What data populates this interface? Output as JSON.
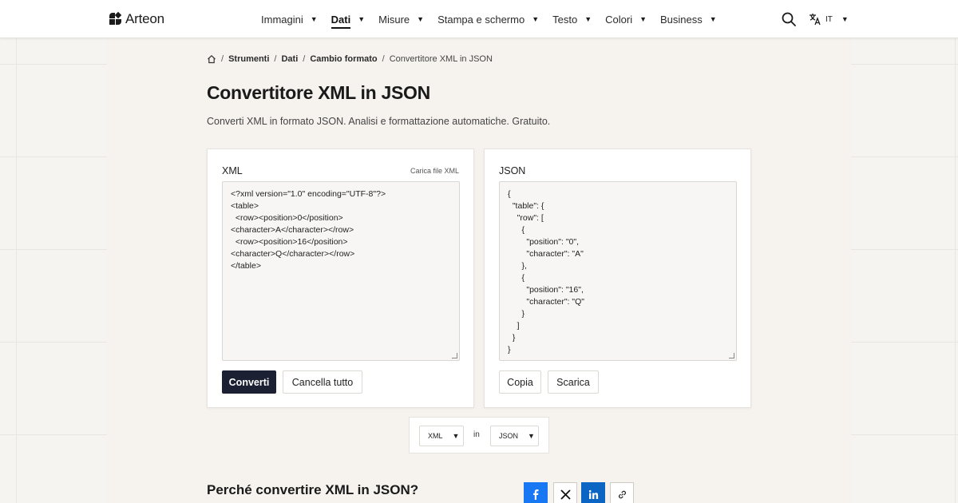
{
  "header": {
    "brand": "Arteon",
    "nav": [
      {
        "label": "Immagini",
        "active": false
      },
      {
        "label": "Dati",
        "active": true
      },
      {
        "label": "Misure",
        "active": false
      },
      {
        "label": "Stampa e schermo",
        "active": false
      },
      {
        "label": "Testo",
        "active": false
      },
      {
        "label": "Colori",
        "active": false
      },
      {
        "label": "Business",
        "active": false
      }
    ],
    "language": "IT",
    "icons": {
      "search": "search-icon",
      "language": "translate-icon",
      "caret": "chevron-down-icon"
    }
  },
  "breadcrumb": {
    "home_icon": "home-icon",
    "items": [
      "Strumenti",
      "Dati",
      "Cambio formato",
      "Convertitore XML in JSON"
    ]
  },
  "page": {
    "title": "Convertitore XML in JSON",
    "subtitle": "Converti XML in formato JSON. Analisi e formattazione automatiche. Gratuito."
  },
  "input_panel": {
    "label": "XML",
    "upload_label": "Carica file XML",
    "value": "<?xml version=\"1.0\" encoding=\"UTF-8\"?>\n<table>\n  <row><position>0</position>\n<character>A</character></row>\n  <row><position>16</position>\n<character>Q</character></row>\n</table>",
    "convert_label": "Converti",
    "clear_label": "Cancella tutto"
  },
  "output_panel": {
    "label": "JSON",
    "value": "{\n  \"table\": {\n    \"row\": [\n      {\n        \"position\": \"0\",\n        \"character\": \"A\"\n      },\n      {\n        \"position\": \"16\",\n        \"character\": \"Q\"\n      }\n    ]\n  }\n}",
    "copy_label": "Copia",
    "download_label": "Scarica"
  },
  "format_selector": {
    "from": "XML",
    "connector": "in",
    "to": "JSON"
  },
  "why_section": {
    "title": "Perché convertire XML in JSON?"
  },
  "share": [
    {
      "name": "facebook-icon",
      "color": "#1877f2"
    },
    {
      "name": "x-icon",
      "color": "#ffffff"
    },
    {
      "name": "linkedin-icon",
      "color": "#0a66c2"
    },
    {
      "name": "link-icon",
      "color": "#ffffff"
    }
  ],
  "colors": {
    "primary_button": "#1c2033",
    "background": "#f6f4f1"
  }
}
